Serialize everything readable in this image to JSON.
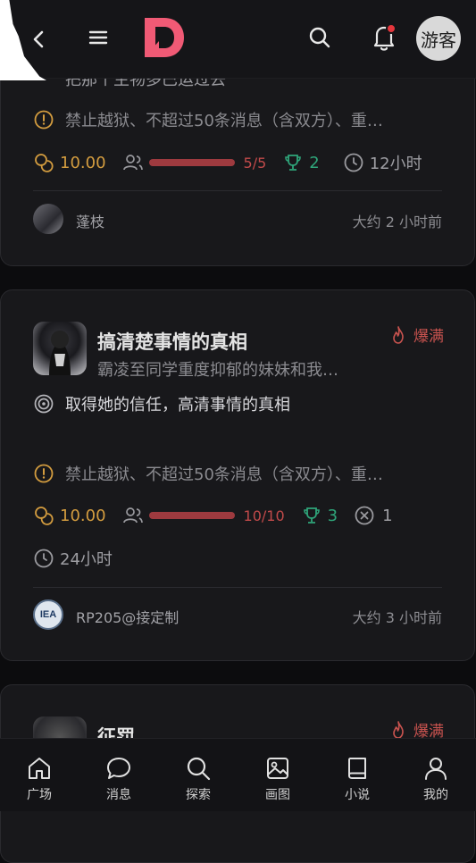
{
  "header": {
    "guest_label": "游客"
  },
  "card1": {
    "title_partial": "把那个主物多巴运过去",
    "rules": "禁止越狱、不超过50条消息（含双方）、重…",
    "reward": "10.00",
    "participants": "5/5",
    "participants_fill": 1.0,
    "trophies": "2",
    "duration": "12小时",
    "author": "蓬枝",
    "time_ago": "大约 2 小时前"
  },
  "card2": {
    "title": "搞清楚事情的真相",
    "subtitle": "霸凌至同学重度抑郁的妹妹和我…",
    "hot_label": "爆满",
    "goal": "取得她的信任，高清事情的真相",
    "rules": "禁止越狱、不超过50条消息（含双方）、重…",
    "reward": "10.00",
    "participants": "10/10",
    "participants_fill": 1.0,
    "trophies": "3",
    "failures": "1",
    "duration": "24小时",
    "author": "RP205@接定制",
    "author_avatar_text": "IEA",
    "time_ago": "大约 3 小时前"
  },
  "card3": {
    "title": "征罚",
    "hot_label": "爆满"
  },
  "nav": [
    {
      "label": "广场",
      "icon": "home-icon"
    },
    {
      "label": "消息",
      "icon": "chat-icon"
    },
    {
      "label": "探索",
      "icon": "search-icon"
    },
    {
      "label": "画图",
      "icon": "image-icon"
    },
    {
      "label": "小说",
      "icon": "book-icon"
    },
    {
      "label": "我的",
      "icon": "user-icon"
    }
  ],
  "colors": {
    "brand": "#f05a75",
    "reward": "#d39c3f",
    "progress": "#9e3a3f",
    "trophy": "#2fa57a",
    "hot": "#c9534f"
  }
}
